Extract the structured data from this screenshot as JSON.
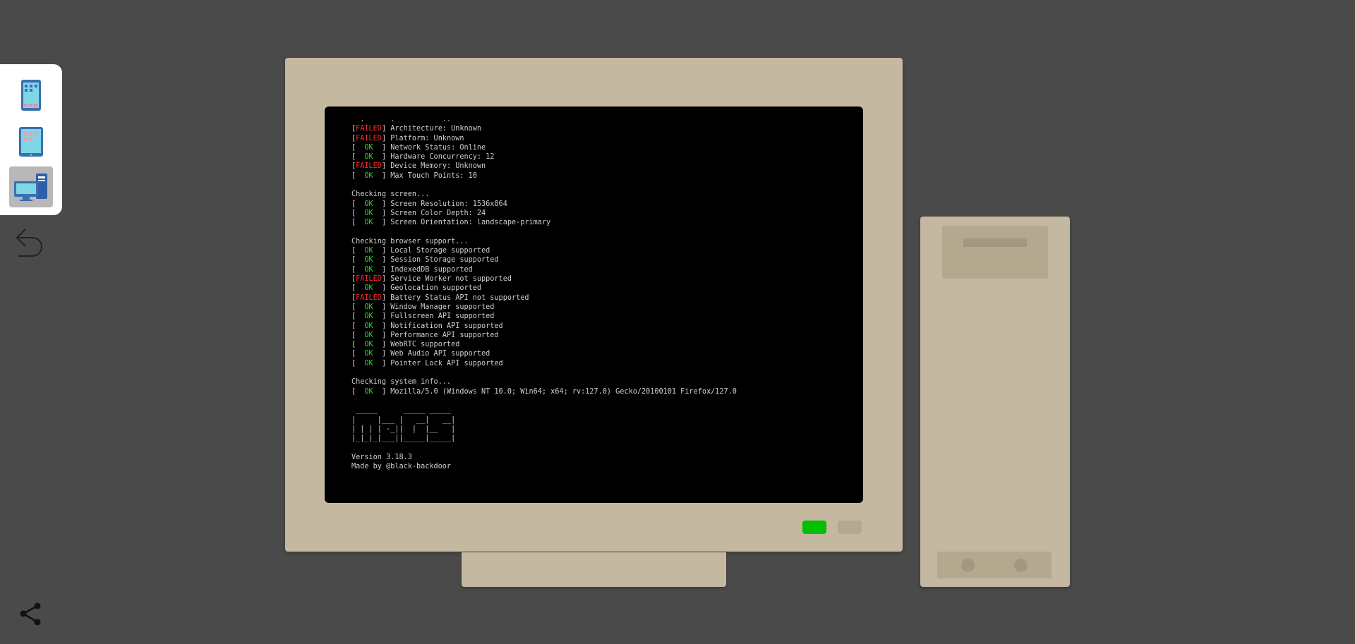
{
  "sidebar": {
    "devices": [
      {
        "name": "phone-icon"
      },
      {
        "name": "tablet-icon"
      },
      {
        "name": "desktop-icon",
        "active": true
      }
    ],
    "back_icon": "undo-arrow-icon",
    "share_icon": "share-icon"
  },
  "terminal": {
    "lines": [
      {
        "status": "",
        "text": "  .      .           .."
      },
      {
        "status": "FAILED",
        "text": " Architecture: Unknown"
      },
      {
        "status": "FAILED",
        "text": " Platform: Unknown"
      },
      {
        "status": "OK",
        "text": " Network Status: Online"
      },
      {
        "status": "OK",
        "text": " Hardware Concurrency: 12"
      },
      {
        "status": "FAILED",
        "text": " Device Memory: Unknown"
      },
      {
        "status": "OK",
        "text": " Max Touch Points: 10"
      },
      {
        "status": "",
        "text": ""
      },
      {
        "status": "",
        "text": "Checking screen..."
      },
      {
        "status": "OK",
        "text": " Screen Resolution: 1536x864"
      },
      {
        "status": "OK",
        "text": " Screen Color Depth: 24"
      },
      {
        "status": "OK",
        "text": " Screen Orientation: landscape-primary"
      },
      {
        "status": "",
        "text": ""
      },
      {
        "status": "",
        "text": "Checking browser support..."
      },
      {
        "status": "OK",
        "text": " Local Storage supported"
      },
      {
        "status": "OK",
        "text": " Session Storage supported"
      },
      {
        "status": "OK",
        "text": " IndexedDB supported"
      },
      {
        "status": "FAILED",
        "text": " Service Worker not supported"
      },
      {
        "status": "OK",
        "text": " Geolocation supported"
      },
      {
        "status": "FAILED",
        "text": " Battery Status API not supported"
      },
      {
        "status": "OK",
        "text": " Window Manager supported"
      },
      {
        "status": "OK",
        "text": " Fullscreen API supported"
      },
      {
        "status": "OK",
        "text": " Notification API supported"
      },
      {
        "status": "OK",
        "text": " Performance API supported"
      },
      {
        "status": "OK",
        "text": " WebRTC supported"
      },
      {
        "status": "OK",
        "text": " Web Audio API supported"
      },
      {
        "status": "OK",
        "text": " Pointer Lock API supported"
      },
      {
        "status": "",
        "text": ""
      },
      {
        "status": "",
        "text": "Checking system info..."
      },
      {
        "status": "OK",
        "text": " Mozilla/5.0 (Windows NT 10.0; Win64; x64; rv:127.0) Gecko/20100101 Firefox/127.0"
      },
      {
        "status": "",
        "text": ""
      },
      {
        "status": "",
        "text": " _____      _____ _____"
      },
      {
        "status": "",
        "text": "|     |___ |   __|   __|"
      },
      {
        "status": "",
        "text": "| | | | -_||  |  |__   |"
      },
      {
        "status": "",
        "text": "|_|_|_|___||_____|_____|"
      },
      {
        "status": "",
        "text": ""
      },
      {
        "status": "",
        "text": "Version 3.18.3"
      },
      {
        "status": "",
        "text": "Made by @black-backdoor"
      }
    ]
  },
  "colors": {
    "background": "#4a4a4a",
    "case": "#c4b8a0",
    "screen": "#000000",
    "ok": "#28d428",
    "failed": "#ff2a2a",
    "power_led": "#00c000"
  }
}
